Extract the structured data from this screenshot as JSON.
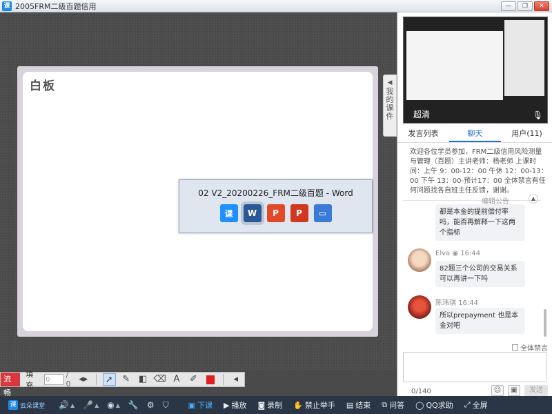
{
  "window": {
    "title": "2005FRM二级百题信用",
    "logo_text": "课"
  },
  "whiteboard": {
    "title": "白板",
    "side_tab_label": "我的课件"
  },
  "taskbar_popup": {
    "title": "02 V2_20200226_FRM二级百题 - Word",
    "icons": [
      {
        "name": "ketang",
        "text": "课"
      },
      {
        "name": "word",
        "text": "W"
      },
      {
        "name": "powerpoint",
        "text": "P"
      },
      {
        "name": "powerpoint-2",
        "text": "P"
      },
      {
        "name": "monitor",
        "text": "▭"
      }
    ]
  },
  "wb_toolbar": {
    "flow_label": "流畅",
    "fill_label": "填充",
    "page_input_value": "0",
    "pages_label": "/ 0",
    "tools": [
      "pointer-icon",
      "pen-icon",
      "shape-icon",
      "eraser-icon",
      "text-icon",
      "highlighter-icon"
    ],
    "color": "#e02020"
  },
  "video": {
    "teacher_name": "超清"
  },
  "tabs": [
    {
      "label": "发言列表",
      "active": false
    },
    {
      "label": "聊天",
      "active": true
    },
    {
      "label": "用户(11)",
      "active": false
    }
  ],
  "notice": {
    "text": "欢迎各位学员参加，FRM二级信用风险测量与管理（百题）主讲老师：杨老师 上课时间：上午 9：00-12：00 午休 12：00-13：00 下午 13：00-预计17：00 全体禁言有任何问题找各自班主任反馈，谢谢。",
    "edit_label": "编辑公告"
  },
  "messages": [
    {
      "name": "",
      "time": "",
      "text": "都是本金的提前偿付率吗，能否再解释一下这两个指标"
    },
    {
      "name": "Elva",
      "time": "16:44",
      "text": "82题三个公司的交易关系可以再讲一下吗"
    },
    {
      "name": "陈玮琪",
      "time": "16:44",
      "text": "所以prepayment 也是本金对吧"
    }
  ],
  "chat_input": {
    "mute_label": "全体禁言",
    "counter": "0/140",
    "send_label": "发送"
  },
  "bottombar": {
    "brand": "云朵课堂",
    "items": [
      {
        "label": "下课",
        "active": true
      },
      {
        "label": "播放",
        "active": false
      },
      {
        "label": "录制",
        "active": false
      },
      {
        "label": "禁止举手",
        "active": false
      },
      {
        "label": "结束",
        "active": false
      },
      {
        "label": "问答",
        "active": false
      },
      {
        "label": "QQ求助",
        "active": false
      },
      {
        "label": "全屏",
        "active": false
      }
    ]
  }
}
